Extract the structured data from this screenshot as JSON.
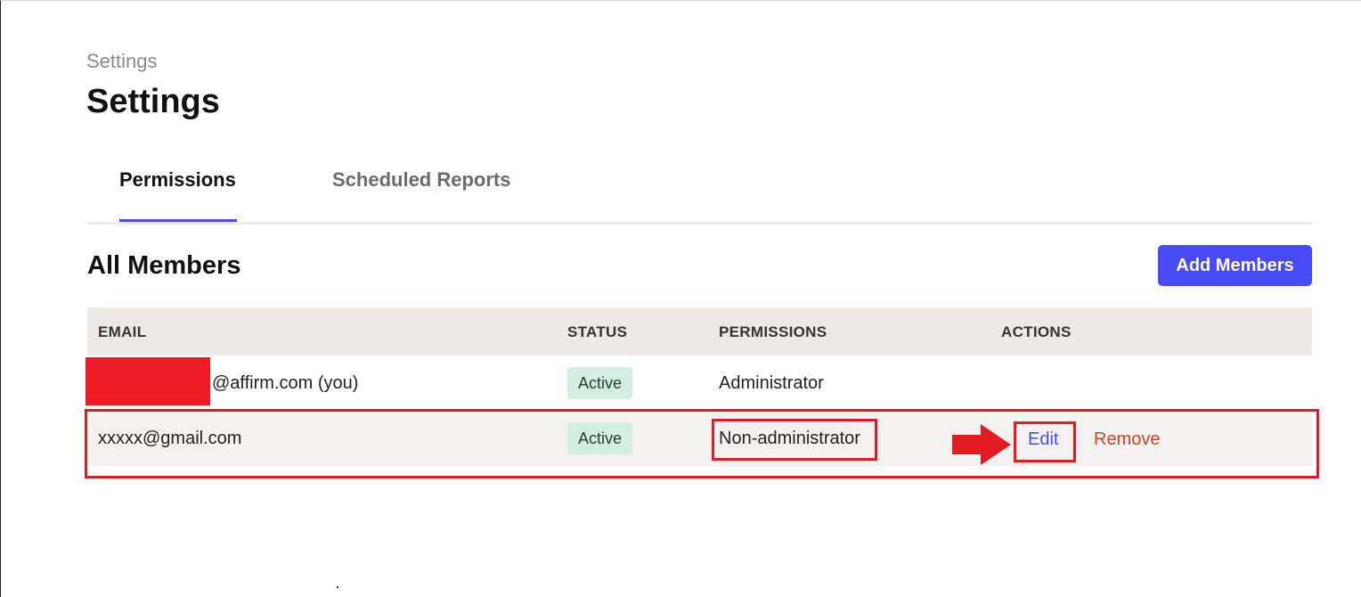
{
  "header": {
    "breadcrumb": "Settings",
    "title": "Settings"
  },
  "tabs": [
    {
      "label": "Permissions",
      "active": true
    },
    {
      "label": "Scheduled Reports",
      "active": false
    }
  ],
  "members": {
    "section_title": "All Members",
    "add_button_label": "Add Members",
    "columns": [
      "EMAIL",
      "STATUS",
      "PERMISSIONS",
      "ACTIONS"
    ],
    "rows": [
      {
        "email": "@affirm.com (you)",
        "status": "Active",
        "permissions": "Administrator",
        "actions": []
      },
      {
        "email": "xxxxx@gmail.com",
        "status": "Active",
        "permissions": "Non-administrator",
        "actions": [
          "Edit",
          "Remove"
        ]
      }
    ]
  },
  "colors": {
    "accent": "#4a4af4",
    "danger": "#c9432f",
    "annotation": "#e31b23",
    "status_bg": "#d3ede2",
    "header_bg": "#ede9e6"
  }
}
